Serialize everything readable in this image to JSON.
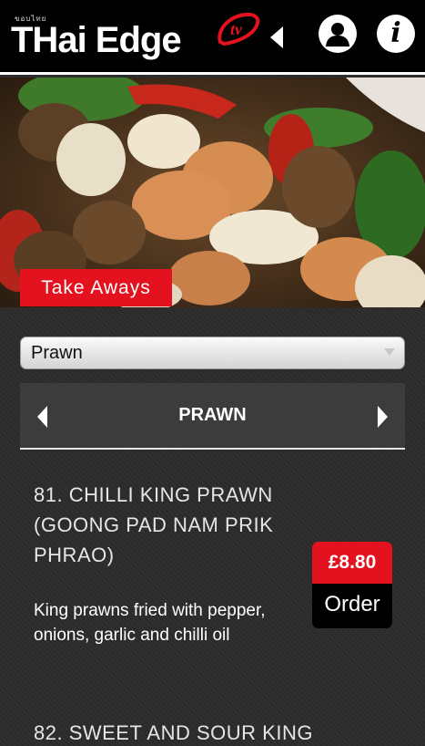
{
  "header": {
    "logo_tagline": "ขอบไทย",
    "logo_text": "THai Edge",
    "logo_tv": "tv"
  },
  "hero": {
    "tag_label": "Take Aways"
  },
  "category_select": {
    "value": "Prawn"
  },
  "category_nav": {
    "title": "PRAWN"
  },
  "items": [
    {
      "title": "81. CHILLI KING PRAWN (GOONG PAD NAM PRIK PHRAO)",
      "description": "King prawns fried with pepper, onions, garlic and chilli oil",
      "price": "£8.80",
      "order_label": "Order"
    },
    {
      "title": "82. SWEET AND SOUR KING"
    }
  ],
  "colors": {
    "accent_red": "#e3121e",
    "topbar": "#000000",
    "background": "#2b2b2b"
  },
  "icons": [
    "back-arrow-icon",
    "user-icon",
    "info-icon",
    "chevron-left-icon",
    "chevron-right-icon",
    "dropdown-arrow-icon"
  ]
}
